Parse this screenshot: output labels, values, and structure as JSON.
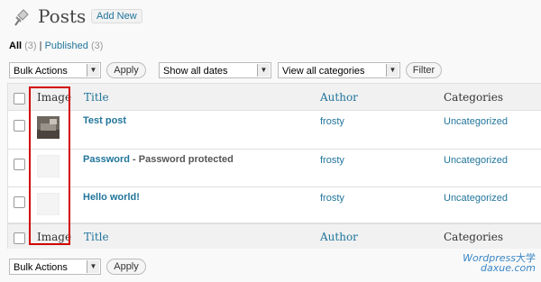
{
  "header": {
    "title": "Posts",
    "add_new": "Add New"
  },
  "views": {
    "all": "All",
    "all_count": "(3)",
    "sep": "|",
    "published": "Published",
    "published_count": "(3)"
  },
  "toolbar": {
    "bulk_actions": "Bulk Actions",
    "apply": "Apply",
    "dates": "Show all dates",
    "categories": "View all categories",
    "filter": "Filter"
  },
  "columns": {
    "image": "Image",
    "title": "Title",
    "author": "Author",
    "categories": "Categories"
  },
  "posts": [
    {
      "title": "Test post",
      "state": "",
      "author": "frosty",
      "category": "Uncategorized"
    },
    {
      "title": "Password",
      "state": " - Password protected",
      "author": "frosty",
      "category": "Uncategorized"
    },
    {
      "title": "Hello world!",
      "state": "",
      "author": "frosty",
      "category": "Uncategorized"
    }
  ],
  "bottom_toolbar": {
    "bulk_actions": "Bulk Actions",
    "apply": "Apply"
  },
  "watermark": {
    "line1": "Wordpress",
    "line1_cn": "大学",
    "line2": "daxue.com"
  },
  "colors": {
    "link": "#21759b",
    "highlight": "#d20000"
  },
  "icons": {
    "pin": "pushpin-icon",
    "dropdown": "triangle-down"
  }
}
